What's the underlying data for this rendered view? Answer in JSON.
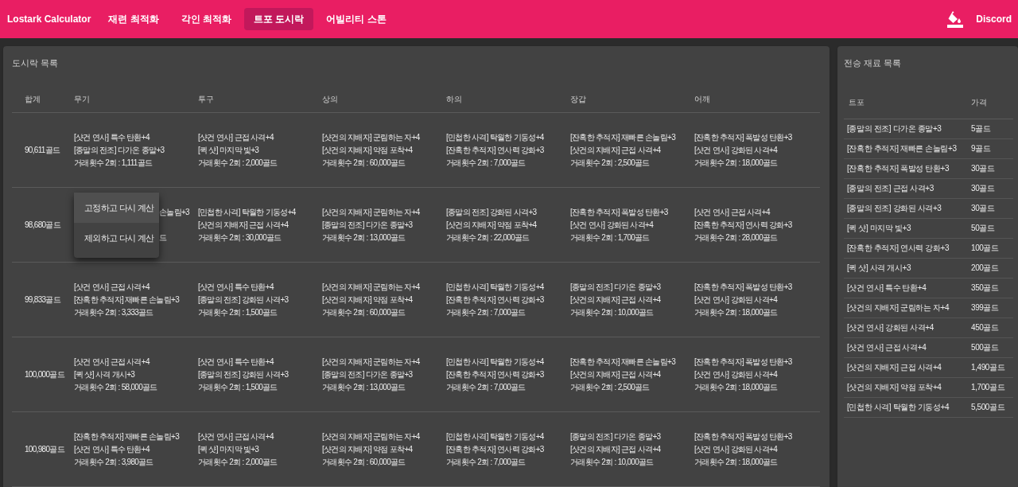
{
  "app": {
    "title": "Lostark Calculator"
  },
  "nav": [
    {
      "label": "재련 최적화",
      "selected": false
    },
    {
      "label": "각인 최적화",
      "selected": false
    },
    {
      "label": "트포 도시락",
      "selected": true
    },
    {
      "label": "어빌리티 스톤",
      "selected": false
    }
  ],
  "discord": "Discord",
  "list": {
    "title": "도시락 목록",
    "columns": [
      "합계",
      "무기",
      "투구",
      "상의",
      "하의",
      "장갑",
      "어깨"
    ],
    "rows": [
      {
        "cells": [
          {
            "kind": "total",
            "text": "90,611골드"
          },
          {
            "kind": "lines",
            "lines": [
              "[샷건 연사] 특수 탄환+4",
              "[종말의 전조] 다가온 종말+3",
              "거래횟수 2회 : 1,111골드"
            ]
          },
          {
            "kind": "lines",
            "lines": [
              "[샷건 연사] 근접 사격+4",
              "[퀵 샷] 마지막 빛+3",
              "거래횟수 2회 : 2,000골드"
            ]
          },
          {
            "kind": "lines",
            "lines": [
              "[샷건의 지배자] 군림하는 자+4",
              "[샷건의 지배자] 약점 포착+4",
              "거래횟수 2회 : 60,000골드"
            ]
          },
          {
            "kind": "lines",
            "lines": [
              "[민첩한 사격] 탁월한 기동성+4",
              "[잔혹한 추적자] 연사력 강화+3",
              "거래횟수 2회 : 7,000골드"
            ]
          },
          {
            "kind": "lines",
            "lines": [
              "[잔혹한 추적자] 재빠른 손놀림+3",
              "[샷건의 지배자] 근접 사격+4",
              "거래횟수 2회 : 2,500골드"
            ]
          },
          {
            "kind": "lines",
            "lines": [
              "[잔혹한 추적자] 폭발성 탄환+3",
              "[샷건 연사] 강화된 사격+4",
              "거래횟수 2회 : 18,000골드"
            ]
          }
        ]
      },
      {
        "cells": [
          {
            "kind": "total",
            "text": "98,680골드"
          },
          {
            "kind": "covered",
            "lines": [
              "손놀림+3",
              "드"
            ]
          },
          {
            "kind": "lines",
            "lines": [
              "[민첩한 사격] 탁월한 기동성+4",
              "[샷건의 지배자] 근접 사격+4",
              "거래횟수 2회 : 30,000골드"
            ]
          },
          {
            "kind": "lines",
            "lines": [
              "[샷건의 지배자] 군림하는 자+4",
              "[종말의 전조] 다가온 종말+3",
              "거래횟수 2회 : 13,000골드"
            ]
          },
          {
            "kind": "lines",
            "lines": [
              "[종말의 전조] 강화된 사격+3",
              "[샷건의 지배자] 약점 포착+4",
              "거래횟수 2회 : 22,000골드"
            ]
          },
          {
            "kind": "lines",
            "lines": [
              "[잔혹한 추적자] 폭발성 탄환+3",
              "[샷건 연사] 강화된 사격+4",
              "거래횟수 2회 : 1,700골드"
            ]
          },
          {
            "kind": "lines",
            "lines": [
              "[샷건 연사] 근접 사격+4",
              "[잔혹한 추적자] 연사력 강화+3",
              "거래횟수 2회 : 28,000골드"
            ]
          }
        ]
      },
      {
        "cells": [
          {
            "kind": "total",
            "text": "99,833골드"
          },
          {
            "kind": "lines",
            "lines": [
              "[샷건 연사] 근접 사격+4",
              "[잔혹한 추적자] 재빠른 손놀림+3",
              "거래횟수 2회 : 3,333골드"
            ]
          },
          {
            "kind": "lines",
            "lines": [
              "[샷건 연사] 특수 탄환+4",
              "[종말의 전조] 강화된 사격+3",
              "거래횟수 2회 : 1,500골드"
            ]
          },
          {
            "kind": "lines",
            "lines": [
              "[샷건의 지배자] 군림하는 자+4",
              "[샷건의 지배자] 약점 포착+4",
              "거래횟수 2회 : 60,000골드"
            ]
          },
          {
            "kind": "lines",
            "lines": [
              "[민첩한 사격] 탁월한 기동성+4",
              "[잔혹한 추적자] 연사력 강화+3",
              "거래횟수 2회 : 7,000골드"
            ]
          },
          {
            "kind": "lines",
            "lines": [
              "[종말의 전조] 다가온 종말+3",
              "[샷건의 지배자] 근접 사격+4",
              "거래횟수 2회 : 10,000골드"
            ]
          },
          {
            "kind": "lines",
            "lines": [
              "[잔혹한 추적자] 폭발성 탄환+3",
              "[샷건 연사] 강화된 사격+4",
              "거래횟수 2회 : 18,000골드"
            ]
          }
        ]
      },
      {
        "cells": [
          {
            "kind": "total",
            "text": "100,000골드"
          },
          {
            "kind": "lines",
            "lines": [
              "[샷건 연사] 근접 사격+4",
              "[퀵 샷] 사격 개시+3",
              "거래횟수 2회 : 58,000골드"
            ]
          },
          {
            "kind": "lines",
            "lines": [
              "[샷건 연사] 특수 탄환+4",
              "[종말의 전조] 강화된 사격+3",
              "거래횟수 2회 : 1,500골드"
            ]
          },
          {
            "kind": "lines",
            "lines": [
              "[샷건의 지배자] 군림하는 자+4",
              "[종말의 전조] 다가온 종말+3",
              "거래횟수 2회 : 13,000골드"
            ]
          },
          {
            "kind": "lines",
            "lines": [
              "[민첩한 사격] 탁월한 기동성+4",
              "[잔혹한 추적자] 연사력 강화+3",
              "거래횟수 2회 : 7,000골드"
            ]
          },
          {
            "kind": "lines",
            "lines": [
              "[잔혹한 추적자] 재빠른 손놀림+3",
              "[샷건의 지배자] 근접 사격+4",
              "거래횟수 2회 : 2,500골드"
            ]
          },
          {
            "kind": "lines",
            "lines": [
              "[잔혹한 추적자] 폭발성 탄환+3",
              "[샷건 연사] 강화된 사격+4",
              "거래횟수 2회 : 18,000골드"
            ]
          }
        ]
      },
      {
        "cells": [
          {
            "kind": "total",
            "text": "100,980골드"
          },
          {
            "kind": "lines",
            "lines": [
              "[잔혹한 추적자] 재빠른 손놀림+3",
              "[샷건 연사] 특수 탄환+4",
              "거래횟수 2회 : 3,980골드"
            ]
          },
          {
            "kind": "lines",
            "lines": [
              "[샷건 연사] 근접 사격+4",
              "[퀵 샷] 마지막 빛+3",
              "거래횟수 2회 : 2,000골드"
            ]
          },
          {
            "kind": "lines",
            "lines": [
              "[샷건의 지배자] 군림하는 자+4",
              "[샷건의 지배자] 약점 포착+4",
              "거래횟수 2회 : 60,000골드"
            ]
          },
          {
            "kind": "lines",
            "lines": [
              "[민첩한 사격] 탁월한 기동성+4",
              "[잔혹한 추적자] 연사력 강화+3",
              "거래횟수 2회 : 7,000골드"
            ]
          },
          {
            "kind": "lines",
            "lines": [
              "[종말의 전조] 다가온 종말+3",
              "[샷건의 지배자] 근접 사격+4",
              "거래횟수 2회 : 10,000골드"
            ]
          },
          {
            "kind": "lines",
            "lines": [
              "[잔혹한 추적자] 폭발성 탄환+3",
              "[샷건 연사] 강화된 사격+4",
              "거래횟수 2회 : 18,000골드"
            ]
          }
        ]
      }
    ]
  },
  "context_menu": {
    "items": [
      {
        "label": "고정하고 다시 계산",
        "selected": true
      },
      {
        "label": "제외하고 다시 계산",
        "selected": false
      }
    ]
  },
  "materials": {
    "title": "전승 재료 목록",
    "columns": [
      "트포",
      "가격"
    ],
    "rows": [
      {
        "name": "[종말의 전조] 다가온 종말+3",
        "price": "5골드"
      },
      {
        "name": "[잔혹한 추적자] 재빠른 손놀림+3",
        "price": "9골드"
      },
      {
        "name": "[잔혹한 추적자] 폭발성 탄환+3",
        "price": "30골드"
      },
      {
        "name": "[종말의 전조] 근접 사격+3",
        "price": "30골드"
      },
      {
        "name": "[종말의 전조] 강화된 사격+3",
        "price": "30골드"
      },
      {
        "name": "[퀵 샷] 마지막 빛+3",
        "price": "50골드"
      },
      {
        "name": "[잔혹한 추적자] 연사력 강화+3",
        "price": "100골드"
      },
      {
        "name": "[퀵 샷] 사격 개시+3",
        "price": "200골드"
      },
      {
        "name": "[샷건 연사] 특수 탄환+4",
        "price": "350골드"
      },
      {
        "name": "[샷건의 지배자] 군림하는 자+4",
        "price": "399골드"
      },
      {
        "name": "[샷건 연사] 강화된 사격+4",
        "price": "450골드"
      },
      {
        "name": "[샷건 연사] 근접 사격+4",
        "price": "500골드"
      },
      {
        "name": "[샷건의 지배자] 근접 사격+4",
        "price": "1,490골드"
      },
      {
        "name": "[샷건의 지배자] 약점 포착+4",
        "price": "1,700골드"
      },
      {
        "name": "[민첩한 사격] 탁월한 기동성+4",
        "price": "5,500골드"
      }
    ]
  }
}
